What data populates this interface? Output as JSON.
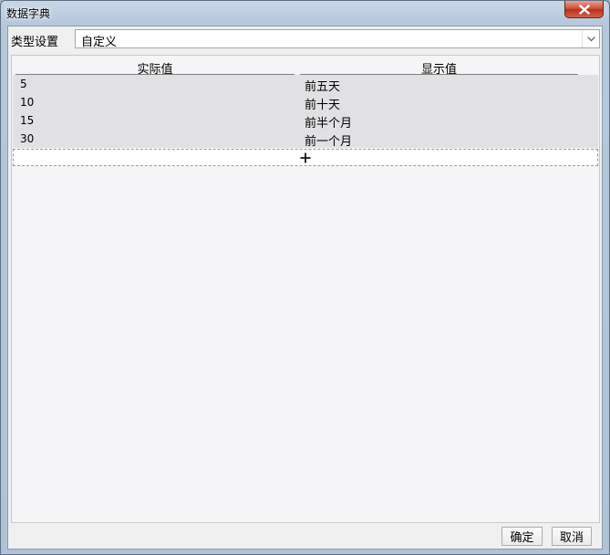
{
  "window": {
    "title": "数据字典"
  },
  "type_setting": {
    "label": "类型设置",
    "value": "自定义"
  },
  "table": {
    "columns": [
      "实际值",
      "显示值"
    ],
    "rows": [
      {
        "value": "5",
        "display": "前五天"
      },
      {
        "value": "10",
        "display": "前十天"
      },
      {
        "value": "15",
        "display": "前半个月"
      },
      {
        "value": "30",
        "display": "前一个月"
      }
    ]
  },
  "footer": {
    "ok_label": "确定",
    "cancel_label": "取消"
  },
  "colors": {
    "close_button": "#c7482f",
    "row_background": "#e1e1e3",
    "panel_background": "#f5f5f7"
  }
}
